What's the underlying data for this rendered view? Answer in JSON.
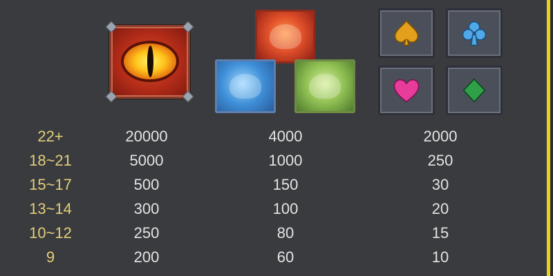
{
  "symbols": {
    "group1": "dragon-eye",
    "group2": [
      "red-dragon",
      "blue-dinosaur",
      "green-frog"
    ],
    "group3": [
      "spade",
      "club",
      "heart",
      "diamond"
    ]
  },
  "colors": {
    "background": "#3a3b3f",
    "count_text": "#e2cf7a",
    "value_text": "#e4e4e4",
    "frame_yellow": "#e8d21e"
  },
  "paytable": {
    "rows": [
      {
        "count": "22+",
        "v1": "20000",
        "v2": "4000",
        "v3": "2000"
      },
      {
        "count": "18~21",
        "v1": "5000",
        "v2": "1000",
        "v3": "250"
      },
      {
        "count": "15~17",
        "v1": "500",
        "v2": "150",
        "v3": "30"
      },
      {
        "count": "13~14",
        "v1": "300",
        "v2": "100",
        "v3": "20"
      },
      {
        "count": "10~12",
        "v1": "250",
        "v2": "80",
        "v3": "15"
      },
      {
        "count": "9",
        "v1": "200",
        "v2": "60",
        "v3": "10"
      }
    ]
  }
}
